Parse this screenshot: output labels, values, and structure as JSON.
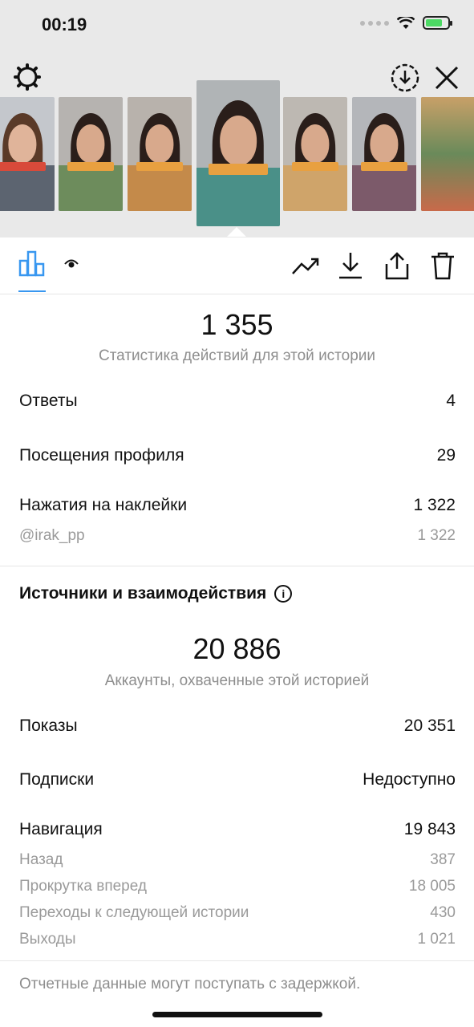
{
  "status_bar": {
    "time": "00:19"
  },
  "toolbar_icons": [
    "settings-icon",
    "download-circle-icon",
    "close-icon",
    "bar-chart-icon",
    "eye-icon",
    "trending-icon",
    "download-icon",
    "share-icon",
    "trash-icon"
  ],
  "colors": {
    "accent": "#3897f0",
    "secondary_text": "#8e8e8e",
    "header_bg": "#e9e9e9"
  },
  "summary": {
    "total": "1 355",
    "caption": "Статистика действий для этой истории"
  },
  "actions": [
    {
      "label": "Ответы",
      "value": "4"
    },
    {
      "label": "Посещения профиля",
      "value": "29"
    },
    {
      "label": "Нажатия на наклейки",
      "value": "1 322"
    }
  ],
  "sticker_sub": {
    "label": "@irak_pp",
    "value": "1 322"
  },
  "discovery": {
    "title": "Источники и взаимодействия",
    "reach": "20 886",
    "reach_caption": "Аккаунты, охваченные этой историей",
    "rows": [
      {
        "label": "Показы",
        "value": "20 351"
      },
      {
        "label": "Подписки",
        "value": "Недоступно"
      },
      {
        "label": "Навигация",
        "value": "19 843"
      }
    ],
    "navigation": [
      {
        "label": "Назад",
        "value": "387"
      },
      {
        "label": "Прокрутка вперед",
        "value": "18 005"
      },
      {
        "label": "Переходы к следующей истории",
        "value": "430"
      },
      {
        "label": "Выходы",
        "value": "1 021"
      }
    ]
  },
  "footer": "Отчетные данные могут поступать с задержкой."
}
